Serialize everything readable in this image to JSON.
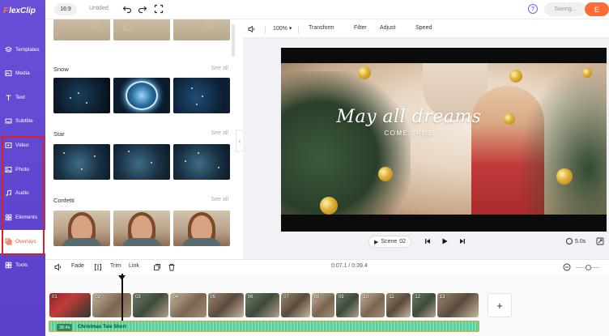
{
  "app": {
    "logo_prefix": "F",
    "logo_rest": "lexClip",
    "brand_color": "#5a3fcb",
    "accent": "#ff6b35"
  },
  "topbar": {
    "ratio": "16:9",
    "title": "Untitled",
    "icons": [
      "undo-icon",
      "redo-icon",
      "fullscreen-icon",
      "help-icon"
    ],
    "saving_label": "Saving...",
    "export_label": "E"
  },
  "nav": {
    "items": [
      {
        "label": "Templates",
        "icon": "templates-icon"
      },
      {
        "label": "Media",
        "icon": "media-icon"
      },
      {
        "label": "Text",
        "icon": "text-icon"
      },
      {
        "label": "Subtitle",
        "icon": "subtitle-icon"
      },
      {
        "label": "Video",
        "icon": "video-icon"
      },
      {
        "label": "Photo",
        "icon": "photo-icon"
      },
      {
        "label": "Audio",
        "icon": "audio-icon"
      },
      {
        "label": "Elements",
        "icon": "elements-icon"
      },
      {
        "label": "Overlays",
        "icon": "overlays-icon",
        "active": true
      },
      {
        "label": "Tools",
        "icon": "tools-icon"
      }
    ]
  },
  "panel": {
    "sections": [
      {
        "title": "Snow",
        "see_all": "See all"
      },
      {
        "title": "Star",
        "see_all": "See all"
      },
      {
        "title": "Confetti",
        "see_all": "See all"
      }
    ]
  },
  "preview_toolbar": {
    "zoom": "100%",
    "items": [
      "Transform",
      "Filter",
      "Adjust",
      "Speed"
    ]
  },
  "video": {
    "headline": "May all dreams",
    "subline": "COME TRUE"
  },
  "playback": {
    "scene_label": "Scene",
    "scene_number": "02",
    "duration": "5.0s"
  },
  "timeline_toolbar": {
    "fade_label": "Fade",
    "trim_label": "Trim",
    "link_label": "Link",
    "time": "0:07.1 / 0:39.4"
  },
  "timeline": {
    "clips": [
      "01",
      "02",
      "03",
      "04",
      "05",
      "06",
      "07",
      "08",
      "09",
      "10",
      "11",
      "12",
      "13"
    ],
    "audio_duration": "39.4s",
    "audio_title": "Christmas Tale Short"
  }
}
